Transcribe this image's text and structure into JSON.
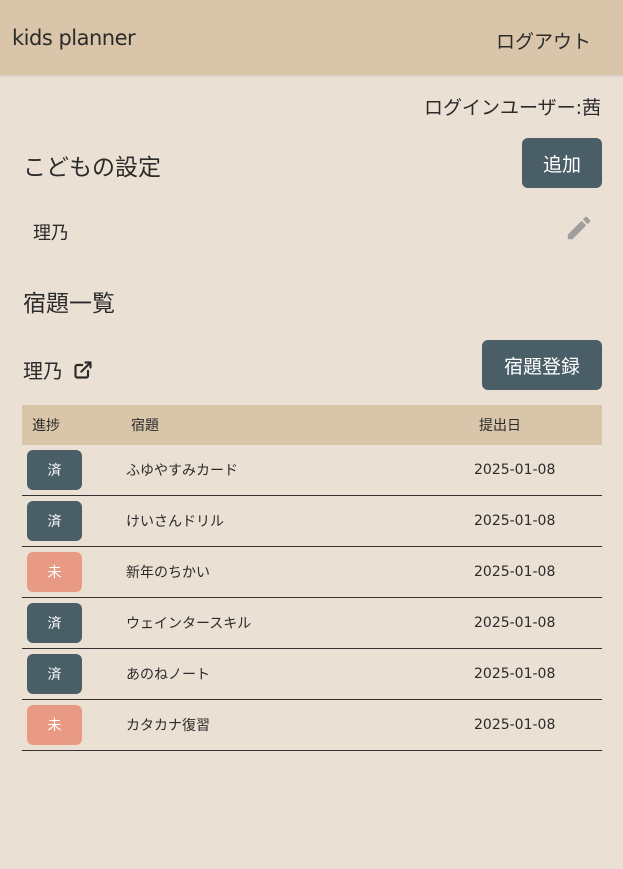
{
  "header": {
    "brand": "kids planner",
    "logout": "ログアウト"
  },
  "login_user": "ログインユーザー:茜",
  "children_settings": {
    "title": "こどもの設定",
    "add_button": "追加",
    "child": "理乃"
  },
  "homework": {
    "title": "宿題一覧",
    "child": "理乃",
    "register_button": "宿題登録",
    "columns": [
      "進捗",
      "宿題",
      "提出日"
    ],
    "rows": [
      {
        "status": "済",
        "state": "done",
        "task": "ふゆやすみカード",
        "date": "2025-01-08"
      },
      {
        "status": "済",
        "state": "done",
        "task": "けいさんドリル",
        "date": "2025-01-08"
      },
      {
        "status": "未",
        "state": "todo",
        "task": "新年のちかい",
        "date": "2025-01-08"
      },
      {
        "status": "済",
        "state": "done",
        "task": "ウェインタースキル",
        "date": "2025-01-08"
      },
      {
        "status": "済",
        "state": "done",
        "task": "あのねノート",
        "date": "2025-01-08"
      },
      {
        "status": "未",
        "state": "todo",
        "task": "カタカナ復習",
        "date": "2025-01-08"
      }
    ]
  },
  "colors": {
    "header_bg": "#d9c5a9",
    "page_bg": "#ebe0d4",
    "button_bg": "#4a5e67",
    "done_badge": "#4a5e67",
    "todo_badge": "#e89a84"
  },
  "icons": {
    "edit": "pencil-icon",
    "open": "external-link-icon"
  }
}
